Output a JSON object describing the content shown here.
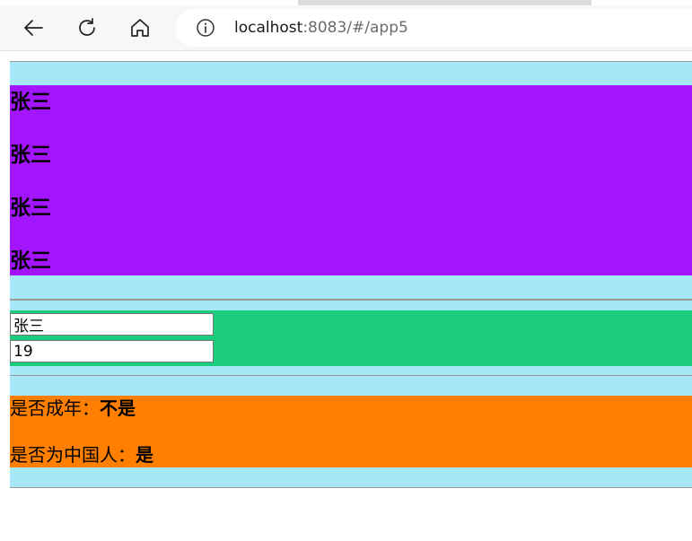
{
  "browser": {
    "url_host": "localhost",
    "url_rest": ":8083/#/app5",
    "icons": [
      "back-arrow-icon",
      "reload-icon",
      "home-icon",
      "info-icon"
    ]
  },
  "names_section": {
    "background": "#a6e8f8",
    "panel_color": "#a415ff",
    "names": [
      "张三",
      "张三",
      "张三",
      "张三"
    ]
  },
  "form_section": {
    "panel_color": "#1bcd7d",
    "name_input_value": "张三",
    "age_input_value": "19"
  },
  "info_section": {
    "panel_color": "#ff7f00",
    "adult_label": "是否成年：",
    "adult_value": "不是",
    "chinese_label": "是否为中国人：",
    "chinese_value": "是"
  }
}
